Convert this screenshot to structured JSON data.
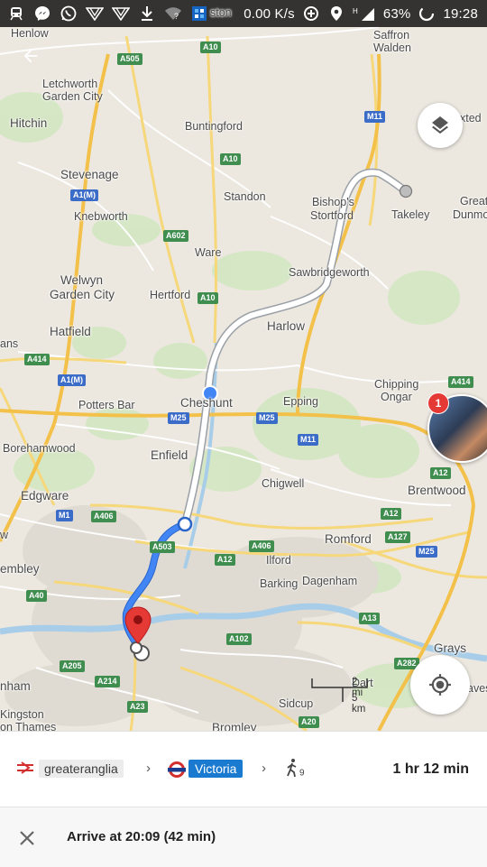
{
  "status_bar": {
    "speed": "0.00 K/s",
    "battery": "63%",
    "time": "19:28",
    "network": "H"
  },
  "map": {
    "place_labels": [
      "Henlow",
      "Saffron",
      "Walden",
      "Letchworth",
      "Garden City",
      "Hitchin",
      "Buntingford",
      "Stevenage",
      "Standon",
      "Bishop's",
      "Stortford",
      "Takeley",
      "Knebworth",
      "xted",
      "Great",
      "Dunmo",
      "Welwyn",
      "Garden City",
      "Ware",
      "Hertford",
      "Sawbridgeworth",
      "Harlow",
      "Hatfield",
      "ans",
      "Cheshunt",
      "Potters Bar",
      "Epping",
      "Chipping",
      "Ongar",
      "Borehamwood",
      "Enfield",
      "Chigwell",
      "Brentwood",
      "Edgware",
      "Romford",
      "w",
      "embley",
      "Ilford",
      "Barking",
      "Dagenham",
      "Grays",
      "nham",
      "Kingston",
      "on Thames",
      "Sidcup",
      "Bromley",
      "aves",
      "ston"
    ],
    "road_badges": [
      "A505",
      "A10",
      "A10",
      "M11",
      "A1(M)",
      "A602",
      "A10",
      "A414",
      "A1(M)",
      "M25",
      "M25",
      "M11",
      "A414",
      "M1",
      "A406",
      "A503",
      "A406",
      "A12",
      "A12",
      "A127",
      "A12",
      "M25",
      "A40",
      "A13",
      "A102",
      "A205",
      "A214",
      "A282",
      "A23",
      "A20"
    ],
    "scale_labels": [
      "2 mi",
      "5 km"
    ],
    "notification_count": "1",
    "icons": {
      "back": "arrow-left-icon",
      "layers": "layers-icon",
      "location": "my-location-icon",
      "destination": "map-pin-icon"
    }
  },
  "route": {
    "operators": [
      {
        "name": "greateranglia",
        "icon": "rail-icon"
      },
      {
        "name": "Victoria",
        "icon": "underground-roundel-icon"
      }
    ],
    "walk_minutes": "9",
    "duration": "1 hr 12 min",
    "arrive_text": "Arrive at 20:09 (42 min)"
  },
  "colors": {
    "route_blue": "#4285f4",
    "route_grey": "#ffffff",
    "pin_red": "#e53935",
    "victoria": "#1a7ad0",
    "road_yellow": "#f6d77a"
  }
}
